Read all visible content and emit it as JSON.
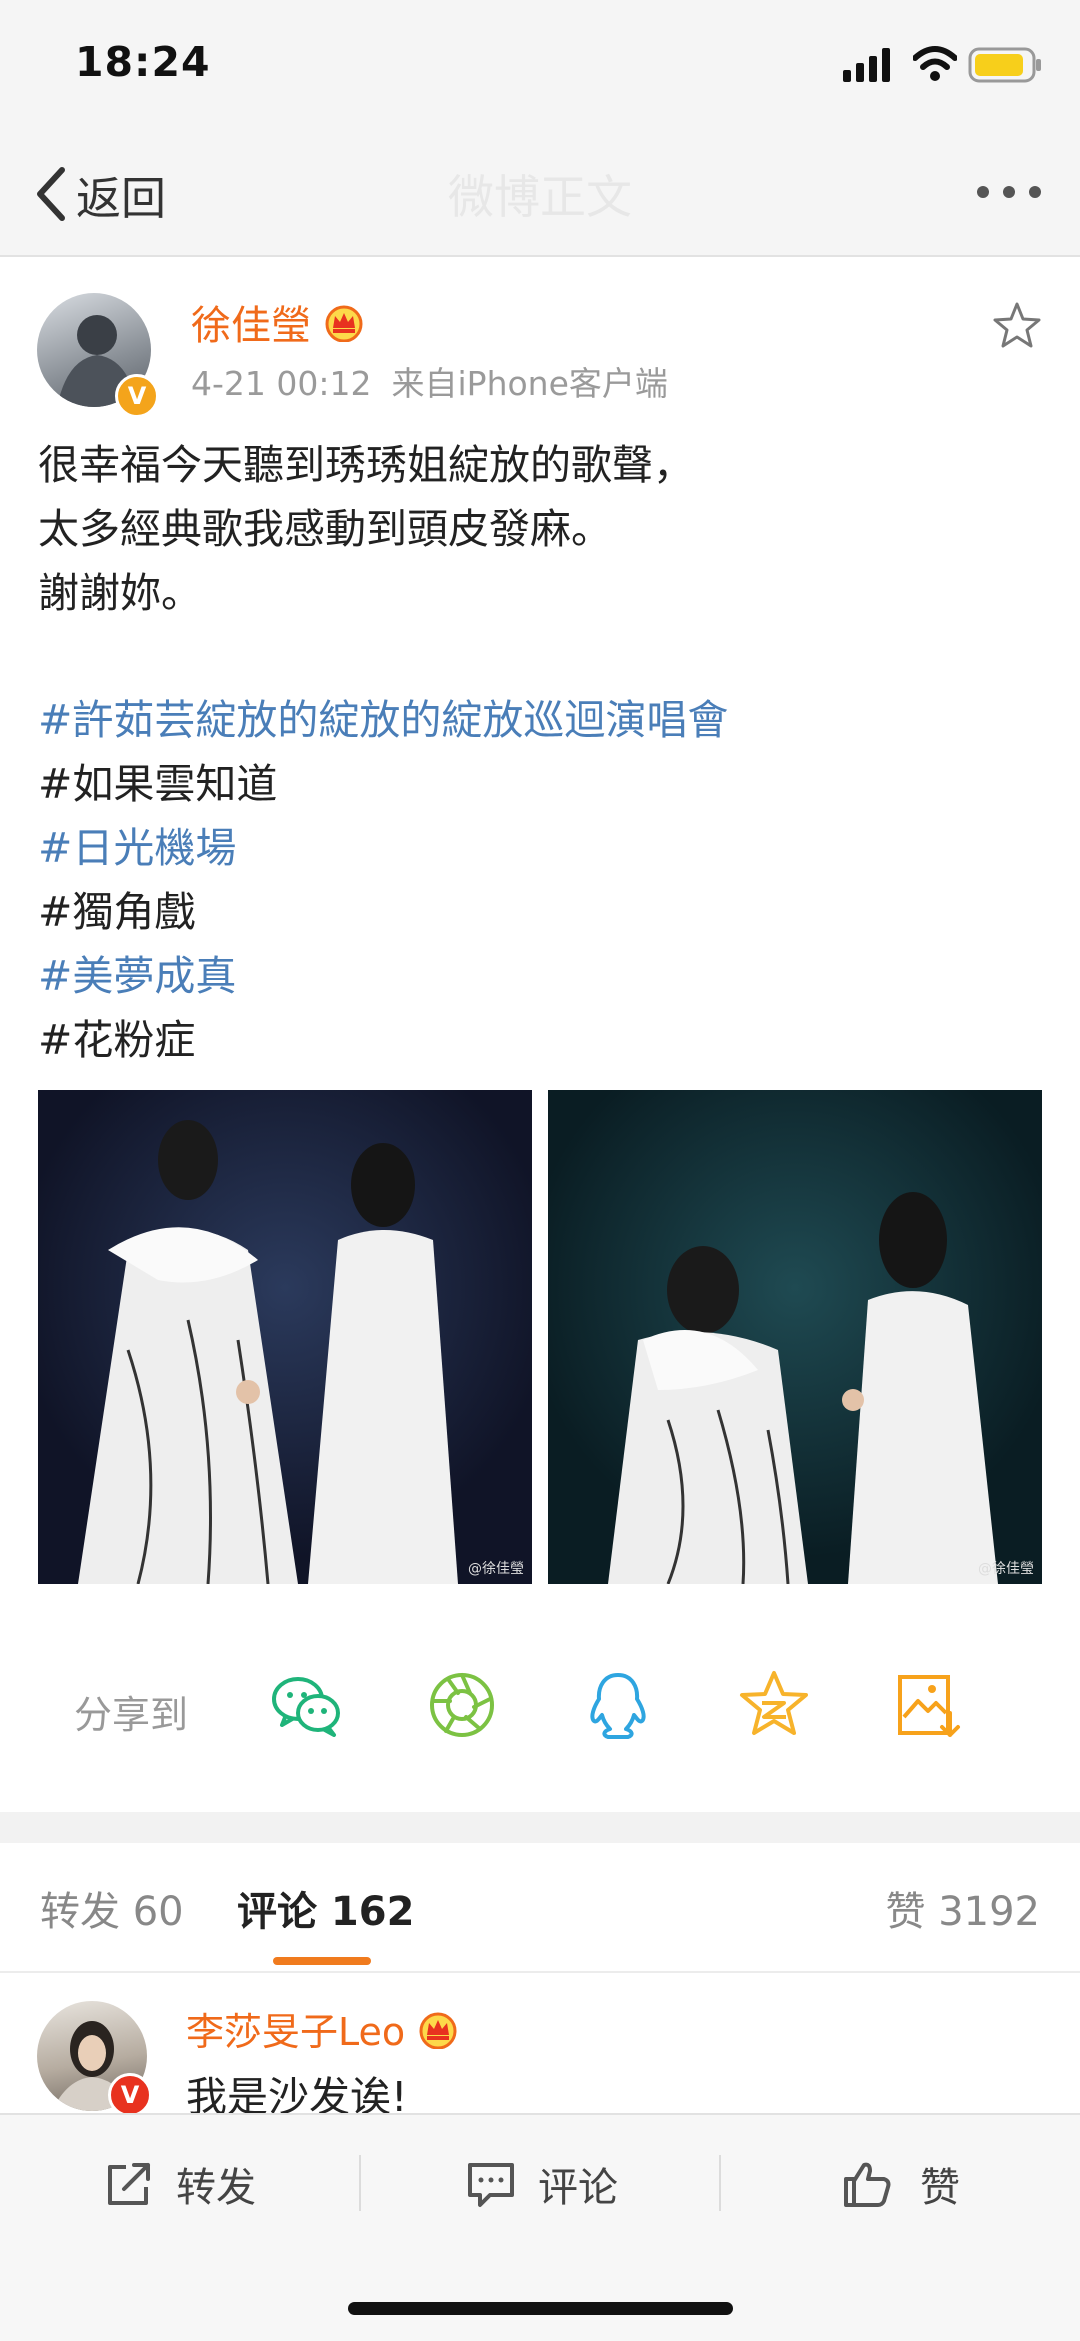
{
  "status_bar": {
    "time": "18:24"
  },
  "nav": {
    "back_label": "返回",
    "title": "微博正文"
  },
  "post": {
    "author": "徐佳瑩",
    "time": "4-21 00:12",
    "source": "来自iPhone客户端",
    "text_lines": [
      "很幸福今天聽到琇琇姐綻放的歌聲，",
      "太多經典歌我感動到頭皮發麻。",
      "謝謝妳。"
    ],
    "tags": [
      {
        "text": "#許茹芸綻放的綻放的綻放巡迴演唱會"
      },
      {
        "text": "#如果雲知道"
      },
      {
        "text": "#日光機場"
      },
      {
        "text": "#獨角戲"
      },
      {
        "text": "#美夢成真"
      },
      {
        "text": "#花粉症"
      }
    ],
    "photo_watermark": "@徐佳瑩",
    "share_label": "分享到",
    "share_icons": [
      "wechat-icon",
      "moments-icon",
      "qq-icon",
      "qzone-icon",
      "save-image-icon"
    ]
  },
  "tabs": {
    "repost": "转发 60",
    "comment": "评论 162",
    "like": "赞 3192"
  },
  "comment": {
    "author": "李莎旻子Leo",
    "text": "我是沙发诶!"
  },
  "toolbar": {
    "repost": "转发",
    "comment": "评论",
    "like": "赞"
  },
  "colors": {
    "accent_orange": "#f06a1a",
    "link_blue": "#4a7eb8",
    "wechat_green": "#1fb47a",
    "qq_blue": "#2ea5e0",
    "star_yellow": "#f7b32b"
  }
}
